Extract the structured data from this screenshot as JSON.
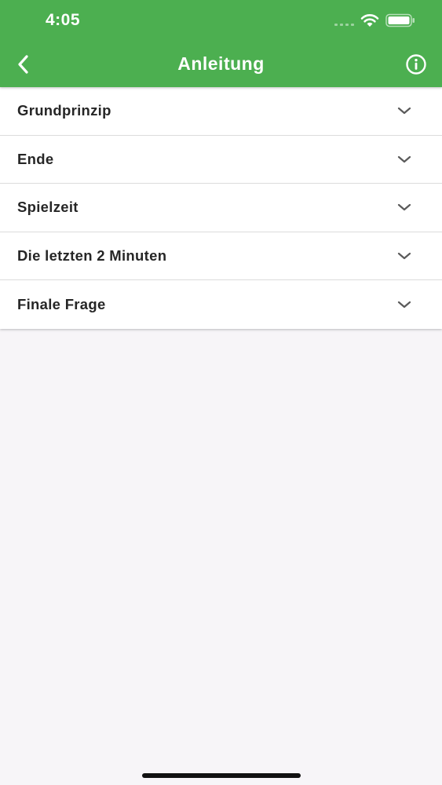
{
  "status_bar": {
    "time": "4:05"
  },
  "nav": {
    "title": "Anleitung",
    "back_icon": "chevron-left-icon",
    "info_icon": "info-circle-icon"
  },
  "sections": [
    {
      "label": "Grundprinzip"
    },
    {
      "label": "Ende"
    },
    {
      "label": "Spielzeit"
    },
    {
      "label": "Die letzten 2 Minuten"
    },
    {
      "label": "Finale Frage"
    }
  ],
  "colors": {
    "header": "#4caf50",
    "background": "#f7f5f8",
    "text": "#262626",
    "chevron": "#5a5a5a"
  }
}
